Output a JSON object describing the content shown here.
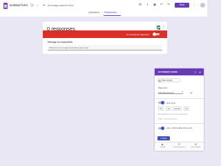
{
  "header": {
    "title": "Untitled form",
    "saved_status": "All changes saved in Drive",
    "send_label": "Send",
    "icons": [
      "folder-icon",
      "star-icon",
      "palette-icon",
      "preview-icon",
      "undo-icon",
      "redo-icon",
      "more-icon"
    ]
  },
  "tabs": [
    {
      "label": "Questions",
      "active": false
    },
    {
      "label": "Responses",
      "active": true
    }
  ],
  "responses": {
    "count_label": "0 responses",
    "not_accepting_label": "Not accepting responses",
    "accepting": false,
    "message_label": "Message for respondents",
    "message_value": "This form is no longer accepting responses"
  },
  "panel": {
    "title": "EXTENDED FORMS",
    "user_name": "Vikas Singhal",
    "share_label": "Share form",
    "share_select": "Link (Anonymous)",
    "time_limit_label": "Time Limit",
    "time_limit_on": true,
    "hours": "00",
    "minutes": "10",
    "minutes_unit": "minutes",
    "seconds": "00",
    "note": "Not applicable to anonymous submission",
    "restrict_label": "Restrict Attempts",
    "auto_submit_label": "Auto - Submit after timer ends",
    "auto_submit_on": true,
    "save_label": "Save",
    "footer": [
      {
        "icon": "tutorial-icon",
        "label": "Tutorials"
      },
      {
        "icon": "results-icon",
        "label": "View Responses"
      },
      {
        "icon": "settings-icon",
        "label": "Form Settings"
      }
    ]
  },
  "colors": {
    "accent": "#673ab7",
    "danger": "#d93025",
    "toggle_on": "#3f51b5",
    "page_bg": "#eae7f4"
  }
}
